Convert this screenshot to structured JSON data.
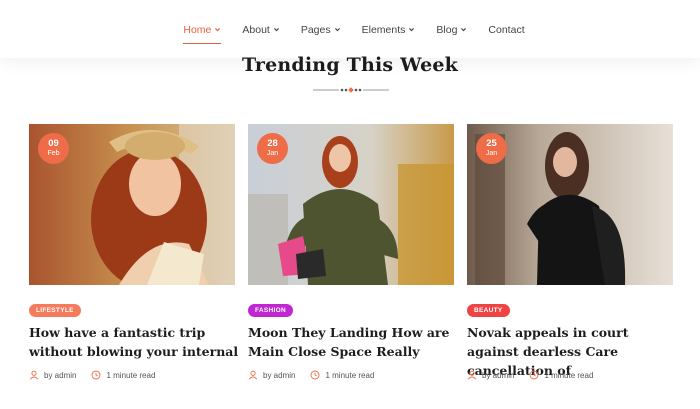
{
  "nav": {
    "items": [
      {
        "label": "Home",
        "dropdown": true,
        "active": true
      },
      {
        "label": "About",
        "dropdown": true,
        "active": false
      },
      {
        "label": "Pages",
        "dropdown": true,
        "active": false
      },
      {
        "label": "Elements",
        "dropdown": true,
        "active": false
      },
      {
        "label": "Blog",
        "dropdown": true,
        "active": false
      },
      {
        "label": "Contact",
        "dropdown": false,
        "active": false
      }
    ]
  },
  "section": {
    "title": "Trending This Week"
  },
  "colors": {
    "accent": "#ef6c48",
    "lifestyle": "#f47c5c",
    "fashion": "#c026d3",
    "beauty": "#ef4444"
  },
  "cards": [
    {
      "date": {
        "day": "09",
        "month": "Feb"
      },
      "category": "LIFESTYLE",
      "title": "How have a fantastic trip without blowing your internal",
      "author": "by admin",
      "read_time": "1 minute read"
    },
    {
      "date": {
        "day": "28",
        "month": "Jan"
      },
      "category": "FASHION",
      "title": "Moon They Landing How are Main Close Space Really",
      "author": "by admin",
      "read_time": "1 minute read"
    },
    {
      "date": {
        "day": "25",
        "month": "Jan"
      },
      "category": "BEAUTY",
      "title": "Novak appeals in court against dearless Care cancellation of",
      "author": "by admin",
      "read_time": "1 minute read"
    }
  ]
}
